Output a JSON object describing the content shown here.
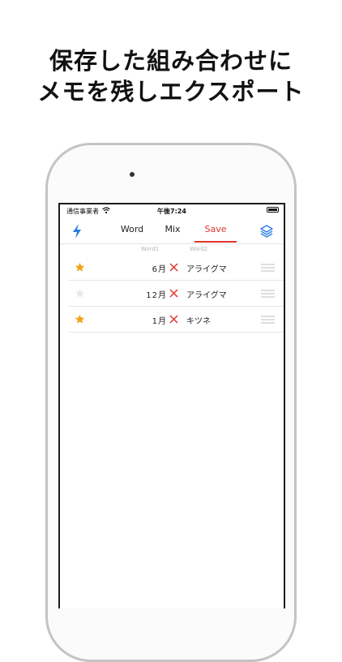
{
  "headline": {
    "line1": "保存した組み合わせに",
    "line2": "メモを残しエクスポート"
  },
  "status": {
    "carrier": "通信事業者",
    "time": "午後7:24"
  },
  "tabs": [
    {
      "label": "Word",
      "active": false
    },
    {
      "label": "Mix",
      "active": false
    },
    {
      "label": "Save",
      "active": true
    }
  ],
  "columns": {
    "word1": "Word1",
    "word2": "Word2"
  },
  "rows": [
    {
      "word1": "6月",
      "word2": "アライグマ",
      "starred": true
    },
    {
      "word1": "12月",
      "word2": "アライグマ",
      "starred": false
    },
    {
      "word1": "1月",
      "word2": "キツネ",
      "starred": true
    }
  ],
  "colors": {
    "accent_red": "#e0332f",
    "star_orange": "#f0a417",
    "star_empty": "#e9e9e9",
    "icon_blue": "#2a7be4"
  },
  "icons": {
    "left_nav": "bolt-icon",
    "right_nav": "layers-icon",
    "row_separator": "cross-icon",
    "row_handle": "drag-handle-icon"
  }
}
